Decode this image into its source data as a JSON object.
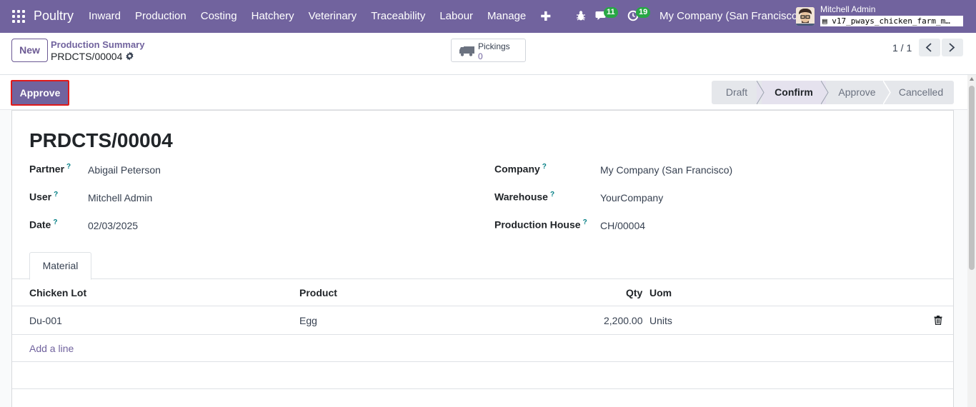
{
  "topnav": {
    "brand": "Poultry",
    "menu": [
      "Inward",
      "Production",
      "Costing",
      "Hatchery",
      "Veterinary",
      "Traceability",
      "Labour",
      "Manage"
    ],
    "add_icon": "plus-icon",
    "messages_count": "11",
    "activities_count": "19",
    "company": "My Company (San Francisco)",
    "user_name": "Mitchell Admin",
    "database": "v17_pways_chicken_farm_m…",
    "bg_color": "#71639e"
  },
  "control": {
    "new_label": "New",
    "breadcrumb": "Production Summary",
    "record_name": "PRDCTS/00004",
    "smart_button": {
      "label": "Pickings",
      "value": "0",
      "icon": "truck-icon"
    },
    "pager": "1 / 1"
  },
  "status": {
    "approve_label": "Approve",
    "stages": [
      "Draft",
      "Confirm",
      "Approve",
      "Cancelled"
    ],
    "active_stage": "Confirm"
  },
  "form": {
    "title": "PRDCTS/00004",
    "left": [
      {
        "label": "Partner",
        "value": "Abigail Peterson"
      },
      {
        "label": "User",
        "value": "Mitchell Admin"
      },
      {
        "label": "Date",
        "value": "02/03/2025"
      }
    ],
    "right": [
      {
        "label": "Company",
        "value": "My Company (San Francisco)"
      },
      {
        "label": "Warehouse",
        "value": "YourCompany"
      },
      {
        "label": "Production House",
        "value": "CH/00004"
      }
    ],
    "help_mark": "?"
  },
  "tabs": [
    "Material"
  ],
  "table": {
    "columns": [
      "Chicken Lot",
      "Product",
      "Qty",
      "Uom"
    ],
    "rows": [
      {
        "chicken_lot": "Du-001",
        "product": "Egg",
        "qty": "2,200.00",
        "uom": "Units"
      }
    ],
    "add_line": "Add a line"
  }
}
